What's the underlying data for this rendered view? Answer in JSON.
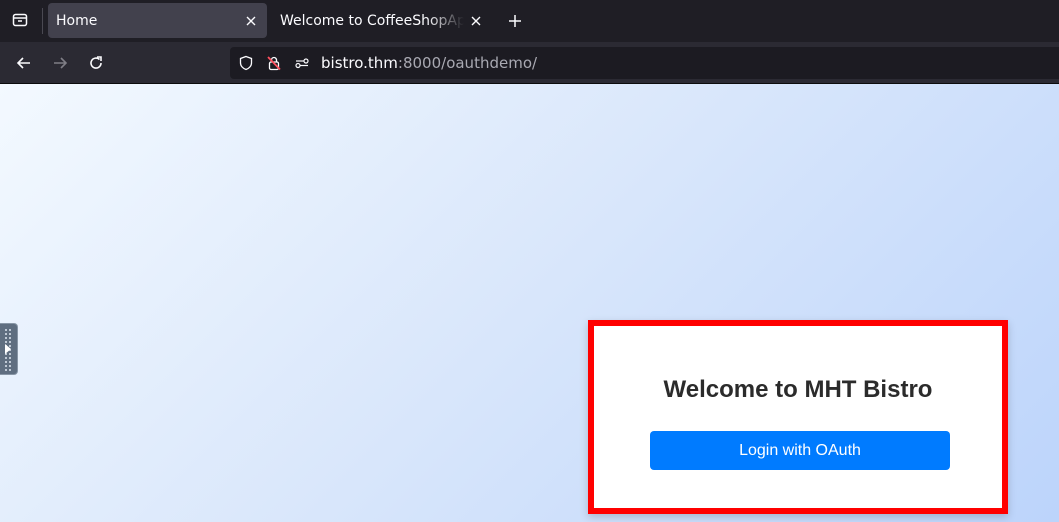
{
  "browser": {
    "tabs": [
      {
        "label": "Home",
        "active": true
      },
      {
        "label": "Welcome to CoffeeShopApp",
        "active": false
      }
    ],
    "url": {
      "host": "bistro.thm",
      "rest": ":8000/oauthdemo/"
    },
    "icons": {
      "overview": "tab-overview-icon",
      "back": "back-arrow-icon",
      "forward": "forward-arrow-icon",
      "reload": "reload-icon",
      "shield": "shield-icon",
      "insecure": "insecure-lock-icon",
      "permissions": "permissions-icon",
      "new_tab": "plus-icon",
      "close": "close-icon"
    }
  },
  "page": {
    "heading": "Welcome to MHT Bistro",
    "login_label": "Login with OAuth"
  },
  "colors": {
    "accent": "#007bff",
    "highlight": "#ff0000"
  }
}
